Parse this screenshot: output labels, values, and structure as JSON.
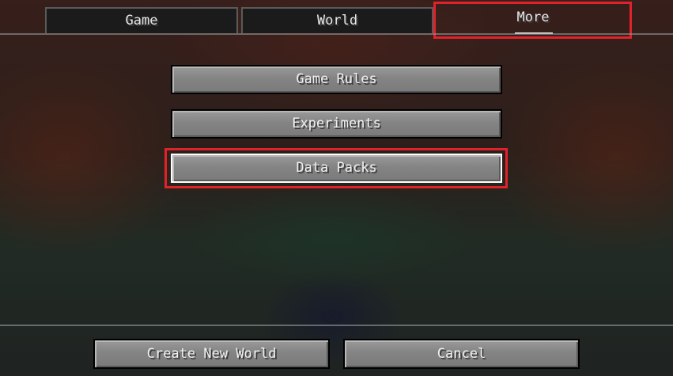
{
  "tabs": [
    {
      "label": "Game"
    },
    {
      "label": "World"
    },
    {
      "label": "More"
    }
  ],
  "active_tab": "More",
  "more_options": [
    {
      "label": "Game Rules"
    },
    {
      "label": "Experiments"
    },
    {
      "label": "Data Packs"
    }
  ],
  "footer": {
    "create_label": "Create New World",
    "cancel_label": "Cancel"
  },
  "colors": {
    "highlight": "#e0222a",
    "button": "#8a8a8a",
    "tab_bg": "#1b1b1b",
    "text": "#e8e8e8"
  }
}
